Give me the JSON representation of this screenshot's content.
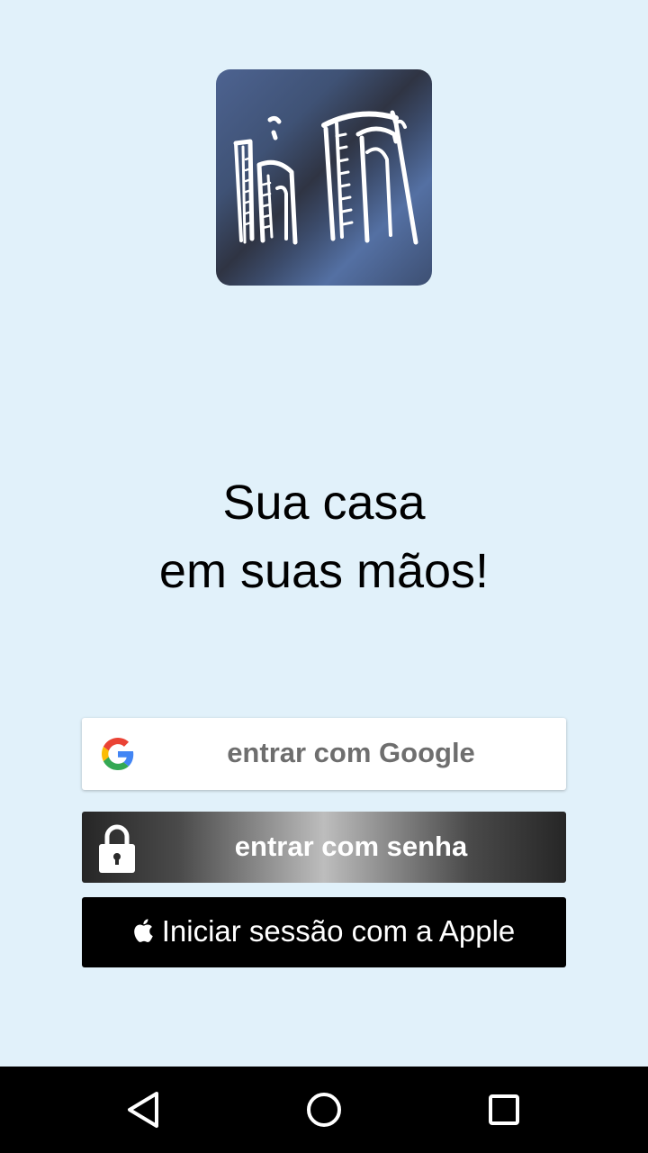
{
  "app": {
    "logo_icon": "buildings-logo-icon"
  },
  "tagline": {
    "line1": "Sua casa",
    "line2": "em suas mãos!"
  },
  "buttons": {
    "google_label": "entrar com Google",
    "senha_label": "entrar com senha",
    "apple_label": "Iniciar sessão com a Apple"
  },
  "icons": {
    "google": "google-g-icon",
    "lock": "lock-icon",
    "apple": "apple-icon",
    "nav_back": "back-triangle-icon",
    "nav_home": "home-circle-icon",
    "nav_recents": "recents-square-icon"
  },
  "colors": {
    "background": "#e1f1fa",
    "google_text": "#6e6e6e",
    "apple_bg": "#000000",
    "navbar": "#000000"
  }
}
